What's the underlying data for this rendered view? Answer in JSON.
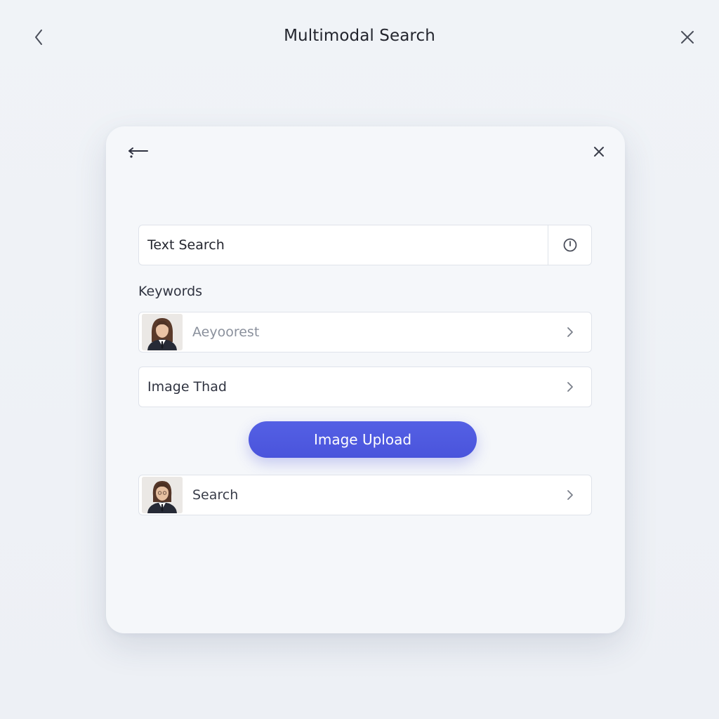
{
  "header": {
    "title": "Multimodal Search",
    "back_icon": "chevron-left-icon",
    "close_icon": "close-icon"
  },
  "card": {
    "back_icon": "arrow-left-icon",
    "close_icon": "close-icon",
    "text_search": {
      "placeholder": "Text Search",
      "value": "",
      "action_icon": "timer-icon"
    },
    "keywords_label": "Keywords",
    "keyword_row": {
      "text": "Aeyoorest",
      "avatar_icon": "person-avatar",
      "chevron_icon": "chevron-right-icon"
    },
    "image_row": {
      "text": "Image Thad",
      "chevron_icon": "chevron-right-icon"
    },
    "upload_button": "Image Upload",
    "search_row": {
      "text": "Search",
      "avatar_icon": "person-avatar",
      "chevron_icon": "chevron-right-icon"
    }
  },
  "colors": {
    "background": "#eef1f6",
    "card": "#f5f7fa",
    "accent": "#4a54dc",
    "field_border": "#dfe3ea"
  }
}
